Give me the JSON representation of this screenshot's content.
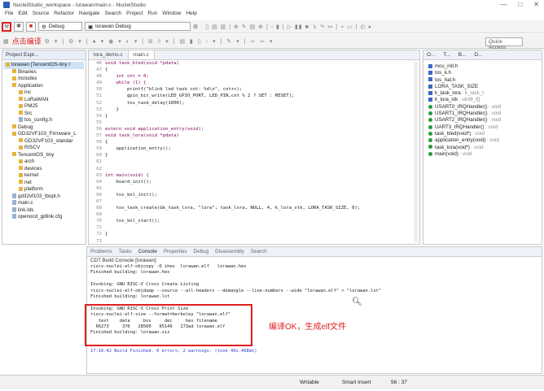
{
  "title": "NucleiStudio_workspace - lorawan/main.c - NucleiStudio",
  "window_controls": [
    "—",
    "□",
    "✕"
  ],
  "menu": [
    "File",
    "Edit",
    "Source",
    "Refactor",
    "Navigate",
    "Search",
    "Project",
    "Run",
    "Window",
    "Help"
  ],
  "toolbar": {
    "mode_combo": "Debug",
    "config_combo": "lorawan Debug",
    "build_annotation": "点击编译",
    "quick_access": "Quick Access"
  },
  "project_explorer": {
    "tab": "Project Expl...",
    "items": [
      {
        "label": "lorawan [TencentOS-tiny r",
        "level": 0,
        "type": "project",
        "selected": true
      },
      {
        "label": "Binaries",
        "level": 1,
        "type": "folder"
      },
      {
        "label": "Includes",
        "level": 1,
        "type": "folder"
      },
      {
        "label": "Application",
        "level": 1,
        "type": "folder"
      },
      {
        "label": "inc",
        "level": 2,
        "type": "folder"
      },
      {
        "label": "LoRaWAN",
        "level": 2,
        "type": "folder"
      },
      {
        "label": "PM25",
        "level": 2,
        "type": "folder"
      },
      {
        "label": "Src",
        "level": 2,
        "type": "folder"
      },
      {
        "label": "tos_config.h",
        "level": 2,
        "type": "file"
      },
      {
        "label": "Debug",
        "level": 1,
        "type": "folder"
      },
      {
        "label": "GD32VF103_Firmware_L",
        "level": 1,
        "type": "folder"
      },
      {
        "label": "GD32VF103_standar",
        "level": 2,
        "type": "folder"
      },
      {
        "label": "RISCV",
        "level": 2,
        "type": "folder"
      },
      {
        "label": "TencentOS_tiny",
        "level": 1,
        "type": "folder"
      },
      {
        "label": "arch",
        "level": 2,
        "type": "folder"
      },
      {
        "label": "devices",
        "level": 2,
        "type": "folder"
      },
      {
        "label": "kernel",
        "level": 2,
        "type": "folder"
      },
      {
        "label": "net",
        "level": 2,
        "type": "folder"
      },
      {
        "label": "platform",
        "level": 2,
        "type": "folder"
      },
      {
        "label": "gd32vf103_lbopt.h",
        "level": 1,
        "type": "file"
      },
      {
        "label": "main.c",
        "level": 1,
        "type": "file"
      },
      {
        "label": "link.lds",
        "level": 1,
        "type": "file"
      },
      {
        "label": "openocd_gdlink.cfg",
        "level": 1,
        "type": "file"
      }
    ]
  },
  "editor": {
    "tabs": [
      "lora_demo.c",
      "main.c"
    ],
    "active_tab": "main.c",
    "lines": [
      {
        "n": "46",
        "text": "void task_bled(void *pdata)"
      },
      {
        "n": "47",
        "text": "{"
      },
      {
        "n": "48",
        "text": "    int cnt = 0;"
      },
      {
        "n": "49",
        "text": "    while (1) {"
      },
      {
        "n": "50",
        "text": "        printf(\"blink led task cnt: %d\\n\", cnt++);"
      },
      {
        "n": "51",
        "text": "        gpio_bit_write(LED_GPIO_PORT, LED_PIN,cnt % 2 ? SET : RESET);"
      },
      {
        "n": "52",
        "text": "        tos_task_delay(1000);"
      },
      {
        "n": "53",
        "text": "    }"
      },
      {
        "n": "54",
        "text": "}"
      },
      {
        "n": "55",
        "text": ""
      },
      {
        "n": "56",
        "text": "extern void application_entry(void);"
      },
      {
        "n": "57",
        "text": "void task_lora(void *pdata)"
      },
      {
        "n": "58",
        "text": "{"
      },
      {
        "n": "59",
        "text": "    application_entry();"
      },
      {
        "n": "60",
        "text": "}"
      },
      {
        "n": "61",
        "text": ""
      },
      {
        "n": "62",
        "text": ""
      },
      {
        "n": "63",
        "text": "int main(void) {"
      },
      {
        "n": "64",
        "text": "    board_init();"
      },
      {
        "n": "65",
        "text": ""
      },
      {
        "n": "66",
        "text": "    tos_knl_init();"
      },
      {
        "n": "67",
        "text": ""
      },
      {
        "n": "68",
        "text": "    tos_task_create(&k_task_lora, \"lora\", task_lora, NULL, 4, k_lora_stk, LORA_TASK_SIZE, 0);"
      },
      {
        "n": "69",
        "text": ""
      },
      {
        "n": "70",
        "text": "    tos_knl_start();"
      },
      {
        "n": "71",
        "text": ""
      },
      {
        "n": "72",
        "text": "}"
      },
      {
        "n": "73",
        "text": ""
      }
    ]
  },
  "outline": {
    "tabs": [
      "O...",
      "T...",
      "B...",
      "D..."
    ],
    "items": [
      {
        "label": "mcu_init.h",
        "kind": "include"
      },
      {
        "label": "tos_k.h",
        "kind": "include"
      },
      {
        "label": "tos_hal.h",
        "kind": "include"
      },
      {
        "label": "LORA_TASK_SIZE",
        "kind": "macro"
      },
      {
        "label": "k_task_lora",
        "type": ": k_task_t",
        "kind": "var"
      },
      {
        "label": "k_lora_stk",
        "type": ": uint8_t[]",
        "kind": "var"
      },
      {
        "label": "USART0_IRQHandler()",
        "type": ": void",
        "kind": "fn"
      },
      {
        "label": "USART1_IRQHandler()",
        "type": ": void",
        "kind": "fn"
      },
      {
        "label": "USART2_IRQHandler()",
        "type": ": void",
        "kind": "fn"
      },
      {
        "label": "UART3_IRQHandler()",
        "type": ": void",
        "kind": "fn"
      },
      {
        "label": "task_bled(void*)",
        "type": ": void",
        "kind": "fn"
      },
      {
        "label": "application_entry(void)",
        "type": ": void",
        "kind": "fn"
      },
      {
        "label": "task_lora(void*)",
        "type": ": void",
        "kind": "fn"
      },
      {
        "label": "main(void)",
        "type": ": void",
        "kind": "fn"
      }
    ]
  },
  "console": {
    "tabs": [
      "Problems",
      "Tasks",
      "Console",
      "Properties",
      "Debug",
      "Disassembly",
      "Search"
    ],
    "active_tab": "Console",
    "header": "CDT Build Console [lorawan]",
    "lines": [
      "riscv-nuclei-elf-objcopy -O ihex  lorawan.elf   lorawan.hex",
      "Finished building: lorawan.hex",
      "",
      "Invoking: GNU RISC-V Cross Create Listing",
      "riscv-nuclei-elf-objdump --source --all-headers --demangle --line-numbers --wide \"lorawan.elf\" > \"lorawan.lst\"",
      "Finished building: lorawan.lst",
      "",
      "Invoking: GNU RISC-V Cross Print Size",
      "riscv-nuclei-elf-size --format=berkeley \"lorawan.elf\"",
      "   text    data     bss     dec     hex filename",
      "  66273     376   28500   95149   173ad lorawan.elf",
      "Finished building: lorawan.siz",
      "",
      "",
      "17:16:42 Build Finished. 0 errors, 2 warnings. (took 49s.468ms)"
    ],
    "annotation": "编译OK，生成elf文件"
  },
  "statusbar": {
    "mode": "Writable",
    "insert": "Smart Insert",
    "position": "56 : 37"
  }
}
